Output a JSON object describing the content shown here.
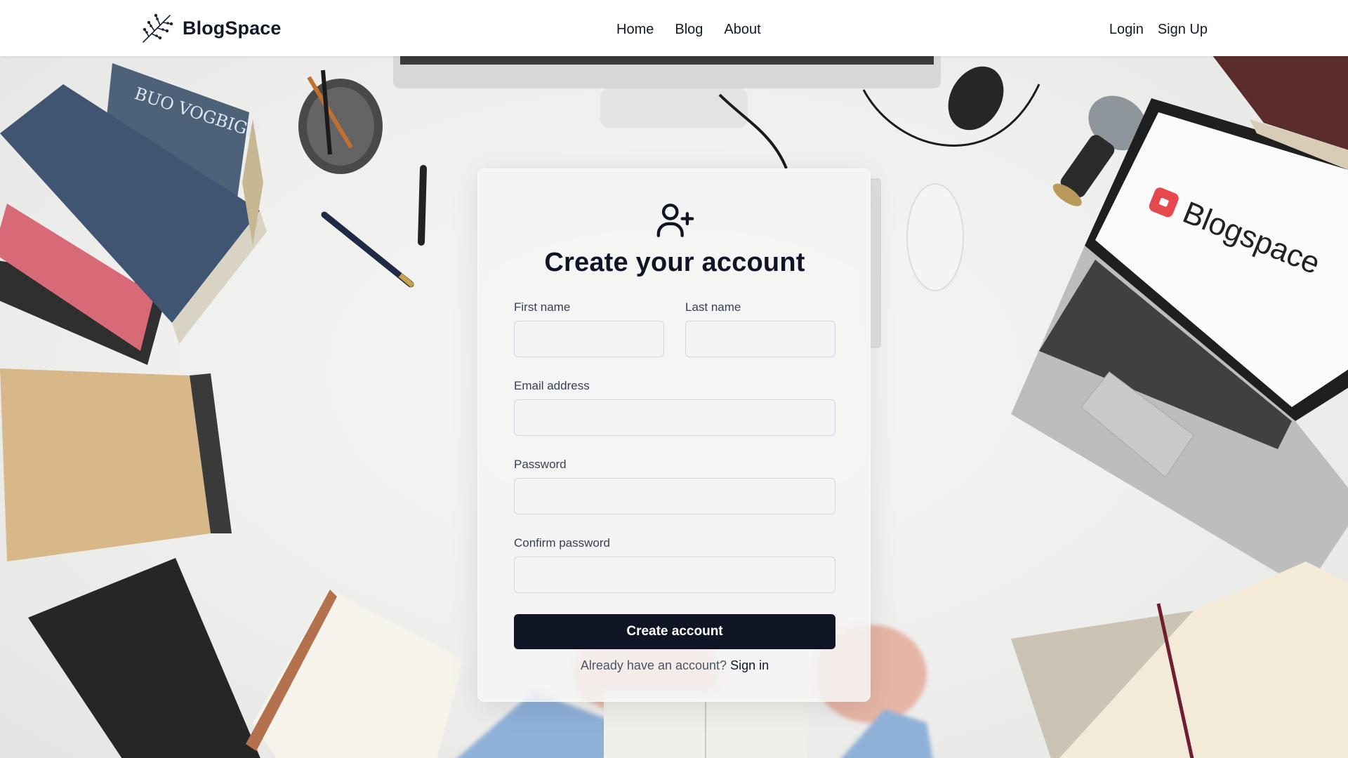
{
  "brand": {
    "name": "BlogSpace",
    "logo_icon": "lavender-sprig-icon"
  },
  "nav": {
    "center": [
      "Home",
      "Blog",
      "About"
    ],
    "right": [
      "Login",
      "Sign Up"
    ]
  },
  "background": {
    "laptop_screen_text": "Blogspace",
    "book_spine_text": "BUO VOGBIGE"
  },
  "form": {
    "icon": "user-plus-icon",
    "title": "Create your account",
    "first_name_label": "First name",
    "last_name_label": "Last name",
    "email_label": "Email address",
    "password_label": "Password",
    "confirm_label": "Confirm password",
    "first_name_value": "",
    "last_name_value": "",
    "email_value": "",
    "password_value": "",
    "confirm_value": "",
    "submit_label": "Create account",
    "signin_prompt": "Already have an account?",
    "signin_link": "Sign in"
  },
  "colors": {
    "primary_button": "#0f1524",
    "heading": "#0f1524",
    "header_bg": "#ffffff",
    "laptop_logo_red": "#e5484d"
  }
}
